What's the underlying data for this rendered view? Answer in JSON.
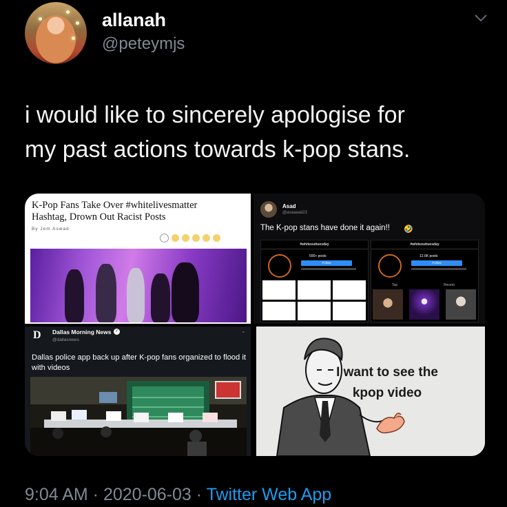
{
  "header": {
    "display_name": "allanah",
    "handle": "@peteymjs"
  },
  "tweet": {
    "text_line1": "i would like to sincerely apologise for",
    "text_line2": "my past actions towards k-pop stans."
  },
  "media": {
    "article": {
      "title_line1": "K-Pop Fans Take Over #whitelivesmatter",
      "title_line2": "Hashtag, Drown Out Racist Posts",
      "byline": "By Jem Aswad"
    },
    "embedded_tweet": {
      "name": "Asad",
      "handle": "@asaaaad23",
      "text": "The K-pop stans have done it again!!",
      "emoji": "🤣",
      "left_profile": {
        "tag": "#whiteouttuesday",
        "count": "500+ posts",
        "follow": "Follow"
      },
      "right_profile": {
        "tag": "#whiteouttuesday",
        "count": "12.6K posts",
        "follow": "Follow",
        "tab_top": "Top",
        "tab_recent": "Recent"
      }
    },
    "news_tweet": {
      "logo": "D",
      "name": "Dallas Morning News",
      "handle": "@dallasnews",
      "text": "Dallas police app back up after K-pop fans organized to flood it with videos"
    },
    "meme": {
      "text_line1": "I want to see the",
      "text_line2": "kpop video"
    }
  },
  "footer": {
    "time": "9:04 AM",
    "sep1": " · ",
    "date": "2020-06-03",
    "sep2": " · ",
    "app": "Twitter Web App"
  },
  "colors": {
    "background": "#000000",
    "secondary_text": "#7f8a94",
    "link": "#1d9bf0"
  }
}
